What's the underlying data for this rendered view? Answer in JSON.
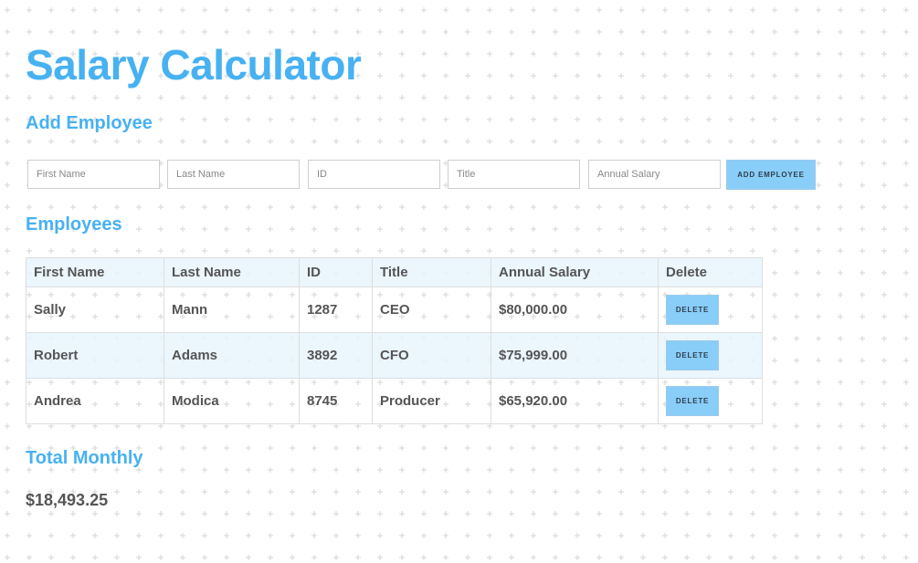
{
  "header": {
    "title": "Salary Calculator"
  },
  "add_employee": {
    "heading": "Add Employee",
    "fields": {
      "first_name_placeholder": "First Name",
      "last_name_placeholder": "Last Name",
      "id_placeholder": "ID",
      "title_placeholder": "Title",
      "annual_salary_placeholder": "Annual Salary"
    },
    "submit_label": "ADD EMPLOYEE"
  },
  "employees": {
    "heading": "Employees",
    "columns": [
      "First Name",
      "Last Name",
      "ID",
      "Title",
      "Annual Salary",
      "Delete"
    ],
    "rows": [
      {
        "first_name": "Sally",
        "last_name": "Mann",
        "id": "1287",
        "title": "CEO",
        "annual_salary": "$80,000.00",
        "delete_label": "DELETE"
      },
      {
        "first_name": "Robert",
        "last_name": "Adams",
        "id": "3892",
        "title": "CFO",
        "annual_salary": "$75,999.00",
        "delete_label": "DELETE"
      },
      {
        "first_name": "Andrea",
        "last_name": "Modica",
        "id": "8745",
        "title": "Producer",
        "annual_salary": "$65,920.00",
        "delete_label": "DELETE"
      }
    ]
  },
  "total_monthly": {
    "heading": "Total Monthly",
    "value": "$18,493.25"
  },
  "colors": {
    "heading_blue": "#47b1f2",
    "button_blue": "#89cdf9",
    "row_highlight": "#e8f4fd",
    "text": "#555555"
  }
}
